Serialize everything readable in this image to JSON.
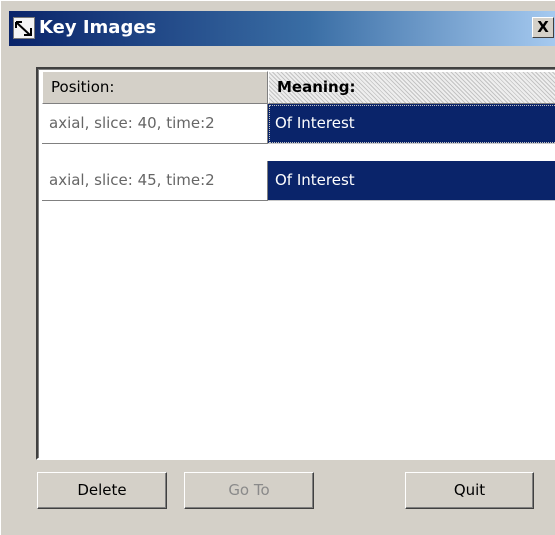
{
  "window": {
    "title": "Key Images",
    "close_label": "X"
  },
  "table": {
    "columns": [
      "Position:",
      "Meaning:"
    ],
    "rows": [
      {
        "position": "axial, slice: 40, time:2",
        "meaning": "Of Interest"
      },
      {
        "position": "axial, slice: 45, time:2",
        "meaning": "Of Interest"
      }
    ]
  },
  "buttons": {
    "delete": "Delete",
    "goto": "Go To",
    "quit": "Quit"
  },
  "colors": {
    "selection": "#0a246a",
    "title_gradient_start": "#0a246a",
    "face": "#d4d0c8"
  },
  "icons": {
    "title": "key-image-arrow-icon"
  }
}
